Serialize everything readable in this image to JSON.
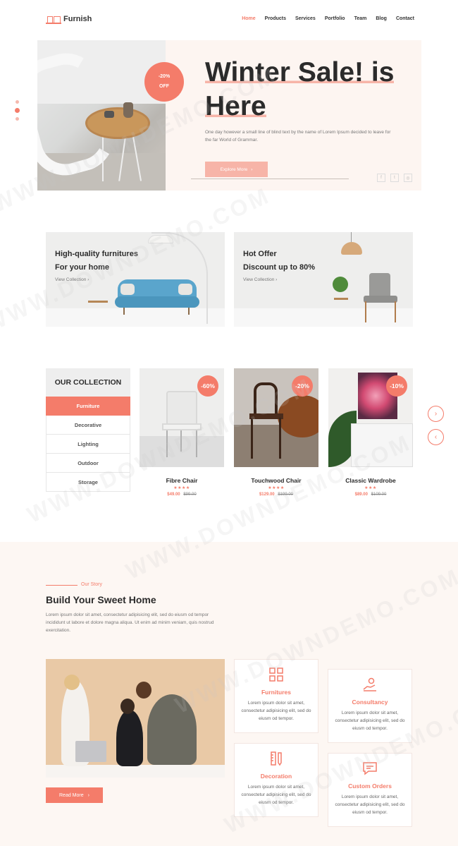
{
  "header": {
    "logo_text": "Furnish",
    "nav": [
      {
        "label": "Home",
        "active": true
      },
      {
        "label": "Products",
        "active": false
      },
      {
        "label": "Services",
        "active": false
      },
      {
        "label": "Portfolio",
        "active": false
      },
      {
        "label": "Team",
        "active": false
      },
      {
        "label": "Blog",
        "active": false
      },
      {
        "label": "Contact",
        "active": false
      }
    ]
  },
  "hero": {
    "badge_top": "-20%",
    "badge_bottom": "OFF",
    "title_line1": "Winter Sale! is",
    "title_line2": "Here",
    "description": "One day however a small line of blind text by the name of Lorem Ipsum decided to leave for the far World of Grammar.",
    "button_label": "Explore More",
    "slide_count": 3,
    "active_slide": 2
  },
  "promos": [
    {
      "title_line1": "High-quality furnitures",
      "title_line2": "For your home",
      "link": "View Collection"
    },
    {
      "title_line1": "Hot Offer",
      "title_line2": "Discount up to 80%",
      "link": "View Collection"
    }
  ],
  "collection": {
    "heading": "OUR COLLECTION",
    "items": [
      {
        "label": "Furniture",
        "active": true
      },
      {
        "label": "Decorative",
        "active": false
      },
      {
        "label": "Lighting",
        "active": false
      },
      {
        "label": "Outdoor",
        "active": false
      },
      {
        "label": "Storage",
        "active": false
      }
    ],
    "products": [
      {
        "name": "Fibre Chair",
        "discount": "-60%",
        "stars": "★★★★",
        "price": "$49.00",
        "old_price": "$99.00"
      },
      {
        "name": "Touchwood Chair",
        "discount": "-20%",
        "stars": "★★★★",
        "price": "$129.00",
        "old_price": "$199.00"
      },
      {
        "name": "Classic Wardrobe",
        "discount": "-10%",
        "stars": "★★★",
        "price": "$89.00",
        "old_price": "$109.00"
      }
    ]
  },
  "story": {
    "eyebrow": "Our Story",
    "title": "Build Your Sweet Home",
    "text": "Lorem ipsum dolor sit amet, consectetur adipisicing elit, sed do eiusm od tempor incididunt ut labore et dolore magna aliqua. Ut enim ad minim veniam, quis nostrud exercitation.",
    "button_label": "Read More"
  },
  "services": [
    {
      "title": "Furnitures",
      "text": "Lorem ipsum dolor sit amet, consectetur adipisicing elit, sed do eiusm od tempor."
    },
    {
      "title": "Consultancy",
      "text": "Lorem ipsum dolor sit amet, consectetur adipisicing elit, sed do eiusm od tempor."
    },
    {
      "title": "Decoration",
      "text": "Lorem ipsum dolor sit amet, consectetur adipisicing elit, sed do eiusm od tempor."
    },
    {
      "title": "Custom Orders",
      "text": "Lorem ipsum dolor sit amet, consectetur adipisicing elit, sed do eiusm od tempor."
    }
  ],
  "watermark": "WWW.DOWNDEMO.COM",
  "colors": {
    "accent": "#f47c6a",
    "accent_light": "#f7b4a8",
    "story_bg": "#fdf7f3"
  }
}
